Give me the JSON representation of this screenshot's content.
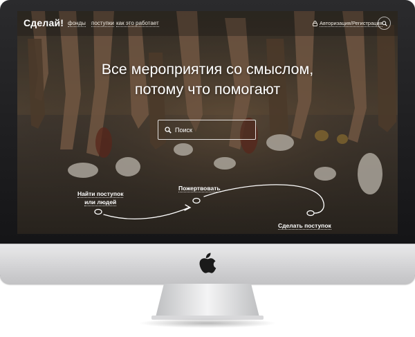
{
  "site": {
    "logo": "Сделай!",
    "nav": [
      {
        "label": "фонды"
      },
      {
        "label": "поступки"
      },
      {
        "label": "как это работает"
      }
    ],
    "auth_label": "Авторизация/Регистрация",
    "auth_icon": "lock-icon",
    "search_icon": "search-icon"
  },
  "hero": {
    "headline_line1": "Все мероприятия со смыслом,",
    "headline_line2": "потому что помогают",
    "search_placeholder": "Поиск"
  },
  "steps": {
    "find_line1": "Найти поступок",
    "find_line2": "или людей",
    "donate": "Пожертвовать",
    "do_deed": "Сделать поступок"
  },
  "colors": {
    "text": "#ffffff",
    "bezel": "#111113",
    "chin": "#d3d3d5"
  }
}
